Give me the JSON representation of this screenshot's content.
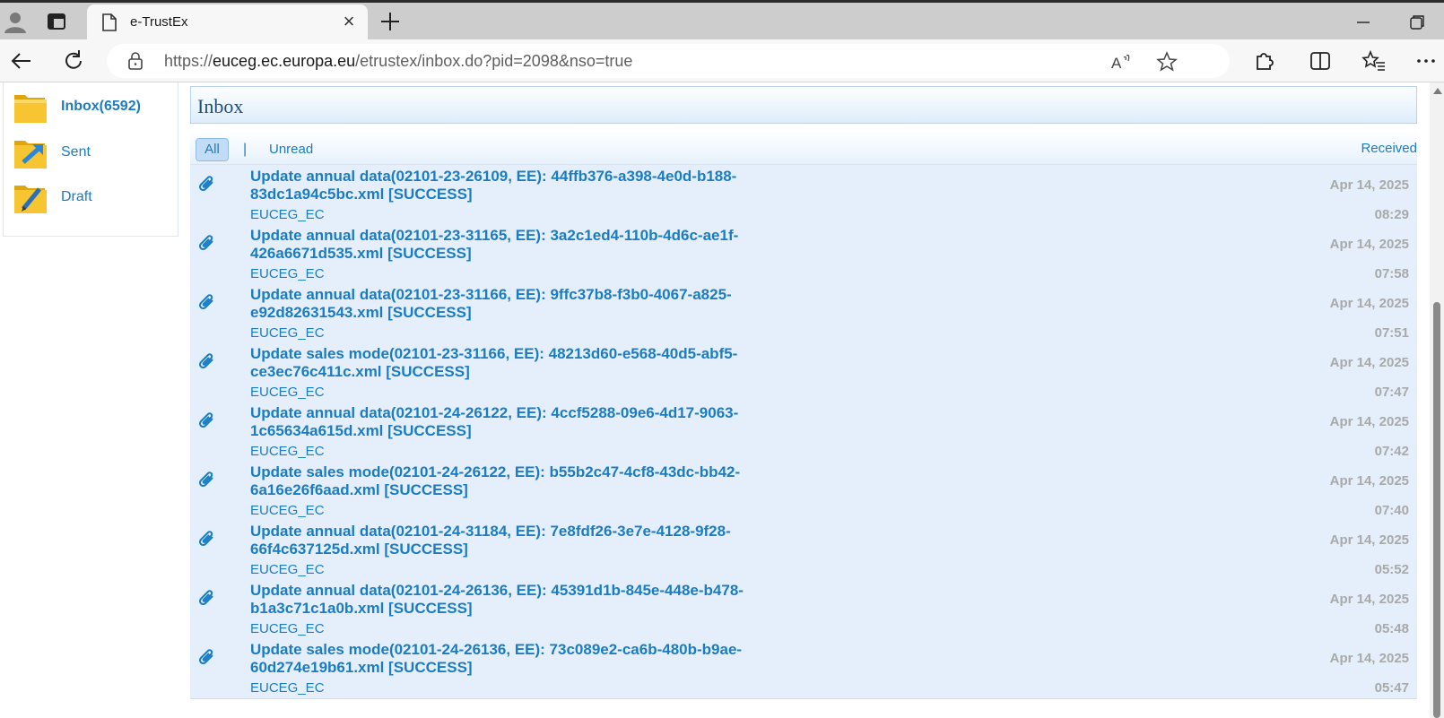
{
  "browser": {
    "tab_title": "e-TrustEx",
    "url_prefix": "https://",
    "url_host": "euceg.ec.europa.eu",
    "url_path": "/etrustex/inbox.do?pid=2098&nso=true",
    "icons": [
      "profile-icon",
      "tab-actions-icon",
      "page-icon",
      "close-icon",
      "new-tab-icon",
      "minimize-icon",
      "restore-icon",
      "back-icon",
      "refresh-icon",
      "lock-icon",
      "read-aloud-icon",
      "favorite-icon",
      "extensions-icon",
      "split-screen-icon",
      "favorites-icon",
      "more-icon"
    ]
  },
  "sidebar": {
    "items": [
      {
        "label": "Inbox(6592)",
        "icon": "inbox-folder-icon"
      },
      {
        "label": "Sent",
        "icon": "sent-folder-icon"
      },
      {
        "label": "Draft",
        "icon": "draft-folder-icon"
      }
    ]
  },
  "inbox": {
    "title": "Inbox",
    "filters": {
      "all": "All",
      "separator": "|",
      "unread": "Unread",
      "received": "Received"
    },
    "messages": [
      {
        "subject": "Update annual data(02101-23-26109, EE): 44ffb376-a398-4e0d-b188-83dc1a94c5bc.xml [SUCCESS]",
        "sender": "EUCEG_EC",
        "date": "Apr 14, 2025",
        "time": "08:29"
      },
      {
        "subject": "Update annual data(02101-23-31165, EE): 3a2c1ed4-110b-4d6c-ae1f-426a6671d535.xml [SUCCESS]",
        "sender": "EUCEG_EC",
        "date": "Apr 14, 2025",
        "time": "07:58"
      },
      {
        "subject": "Update annual data(02101-23-31166, EE): 9ffc37b8-f3b0-4067-a825-e92d82631543.xml [SUCCESS]",
        "sender": "EUCEG_EC",
        "date": "Apr 14, 2025",
        "time": "07:51"
      },
      {
        "subject": "Update sales mode(02101-23-31166, EE): 48213d60-e568-40d5-abf5-ce3ec76c411c.xml [SUCCESS]",
        "sender": "EUCEG_EC",
        "date": "Apr 14, 2025",
        "time": "07:47"
      },
      {
        "subject": "Update annual data(02101-24-26122, EE): 4ccf5288-09e6-4d17-9063-1c65634a615d.xml [SUCCESS]",
        "sender": "EUCEG_EC",
        "date": "Apr 14, 2025",
        "time": "07:42"
      },
      {
        "subject": "Update sales mode(02101-24-26122, EE): b55b2c47-4cf8-43dc-bb42-6a16e26f6aad.xml [SUCCESS]",
        "sender": "EUCEG_EC",
        "date": "Apr 14, 2025",
        "time": "07:40"
      },
      {
        "subject": "Update annual data(02101-24-31184, EE): 7e8fdf26-3e7e-4128-9f28-66f4c637125d.xml [SUCCESS]",
        "sender": "EUCEG_EC",
        "date": "Apr 14, 2025",
        "time": "05:52"
      },
      {
        "subject": "Update annual data(02101-24-26136, EE): 45391d1b-845e-448e-b478-b1a3c71c1a0b.xml [SUCCESS]",
        "sender": "EUCEG_EC",
        "date": "Apr 14, 2025",
        "time": "05:48"
      },
      {
        "subject": "Update sales mode(02101-24-26136, EE): 73c089e2-ca6b-480b-b9ae-60d274e19b61.xml [SUCCESS]",
        "sender": "EUCEG_EC",
        "date": "Apr 14, 2025",
        "time": "05:47"
      }
    ]
  },
  "colors": {
    "link": "#1c7cc2",
    "row_bg": "#e4effb",
    "date": "#a9a9a9"
  }
}
